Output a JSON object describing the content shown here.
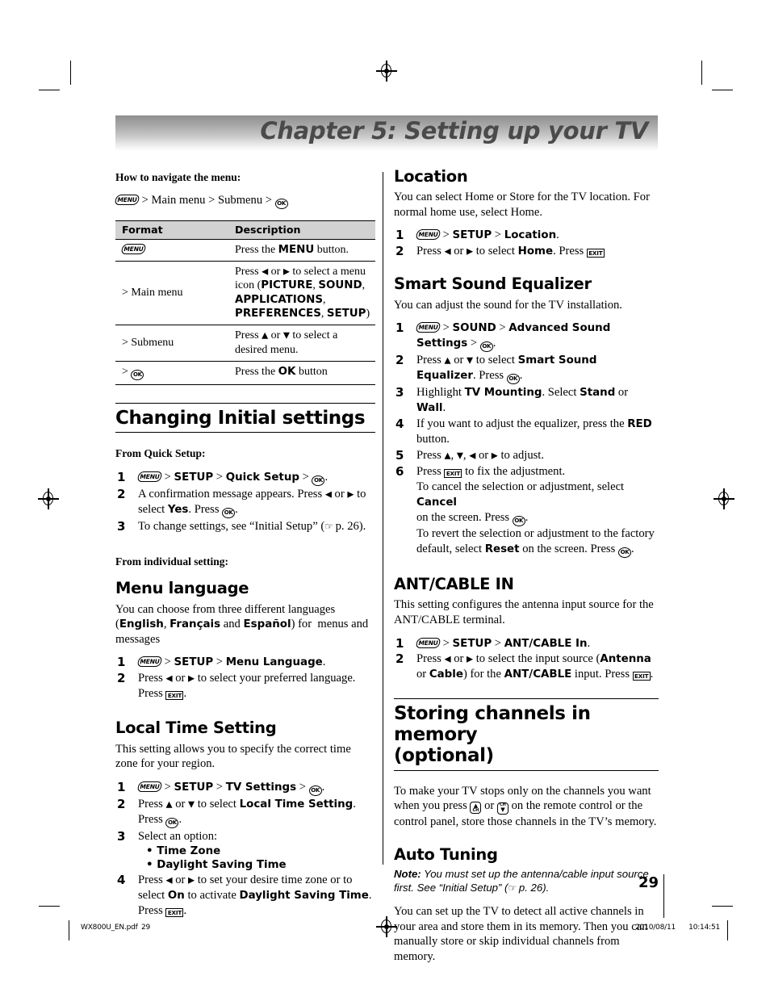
{
  "document": {
    "chapter_title": "Chapter 5: Setting up your TV",
    "page_number": "29",
    "footer_filename": "WX800U_EN.pdf",
    "footer_page": "29",
    "footer_date": "2010/08/11",
    "footer_time": "10:14:51"
  },
  "left_column": {
    "navigate_heading": "How to navigate the menu:",
    "navigate_path": {
      "menu_icon": "menu-key-icon",
      "sep1": ">",
      "main_menu": "Main menu",
      "sep2": ">",
      "submenu": "Submenu",
      "sep3": ">",
      "ok_icon": "ok-key-icon"
    },
    "table": {
      "headers": [
        "Format",
        "Description"
      ],
      "rows": [
        {
          "format_icon": "menu-key-icon",
          "format": "",
          "description_parts": [
            "Press the ",
            "MENU",
            " button."
          ]
        },
        {
          "format": "> Main menu",
          "description_parts": [
            "Press ",
            "◀",
            " or ",
            "▶",
            " to select a menu icon (",
            "PICTURE",
            ", ",
            "SOUND",
            ", ",
            "APPLICATIONS",
            ", ",
            "PREFERENCES",
            ", ",
            "SETUP",
            ")"
          ]
        },
        {
          "format": "> Submenu",
          "description_parts": [
            "Press ",
            "▲",
            " or ",
            "▼",
            " to select a desired menu."
          ]
        },
        {
          "format": ">",
          "format_icon": "ok-key-icon",
          "description_parts": [
            "Press the ",
            "OK",
            " button"
          ]
        }
      ]
    },
    "changing_initial_settings": {
      "heading": "Changing Initial settings",
      "quick_setup_label": "From Quick Setup:",
      "steps": [
        {
          "parts": [
            "MENU_ICON",
            " > ",
            "SETUP",
            " > ",
            "Quick Setup",
            " > ",
            "OK_ICON",
            "."
          ]
        },
        {
          "text": "A confirmation message appears. Press ◀ or ▶ to select Yes. Press OK."
        },
        {
          "text": "To change settings, see “Initial Setup” (☞ p. 26)."
        }
      ],
      "individual_setting_label": "From  individual setting:"
    },
    "menu_language": {
      "heading": "Menu language",
      "body": "You can choose from three different languages (English, Français and Español) for  menus and messages",
      "languages": [
        "English",
        "Français",
        "Español"
      ],
      "steps": [
        {
          "text": "MENU > SETUP > Menu Language."
        },
        {
          "text": "Press ◀ or ▶ to select your preferred language. Press EXIT."
        }
      ]
    },
    "local_time_setting": {
      "heading": "Local Time Setting",
      "body": "This setting allows you to specify the correct time zone for your region.",
      "steps": [
        {
          "text": "MENU > SETUP > TV Settings > OK."
        },
        {
          "text": "Press ▲ or ▼ to select Local Time Setting. Press OK."
        },
        {
          "text": "Select an option:",
          "bullets": [
            "Time Zone",
            "Daylight Saving Time"
          ]
        },
        {
          "text": "Press ◀ or ▶ to set your desire time zone or to select On to activate Daylight Saving Time. Press EXIT."
        }
      ]
    }
  },
  "right_column": {
    "location": {
      "heading": "Location",
      "body": "You can select Home or Store for the TV location. For normal home use, select Home.",
      "steps": [
        {
          "text": "MENU > SETUP > Location."
        },
        {
          "text": "Press ◀ or ▶ to select Home. Press EXIT"
        }
      ]
    },
    "smart_sound_equalizer": {
      "heading": "Smart Sound Equalizer",
      "body": "You can adjust the sound for the TV installation.",
      "steps": [
        {
          "text": "MENU > SOUND > Advanced Sound Settings > OK."
        },
        {
          "text": "Press ▲ or ▼ to select Smart Sound Equalizer. Press OK."
        },
        {
          "text": "Highlight TV Mounting. Select Stand or Wall."
        },
        {
          "text": "If you want to adjust the equalizer, press the RED button."
        },
        {
          "text": "Press ▲, ▼, ◀ or ▶ to adjust."
        },
        {
          "text": "Press EXIT to fix the adjustment. To cancel the selection or adjustment, select Cancel on the screen. Press OK. To revert the selection or adjustment to the factory default, select Reset on the screen. Press OK."
        }
      ]
    },
    "ant_cable_in": {
      "heading": "ANT/CABLE IN",
      "body": "This setting configures the antenna input source for the ANT/CABLE terminal.",
      "steps": [
        {
          "text": "MENU > SETUP > ANT/CABLE In."
        },
        {
          "text": "Press ◀ or ▶ to select the input source (Antenna or Cable) for the ANT/CABLE input. Press EXIT."
        }
      ]
    },
    "storing_channels": {
      "heading_line1": "Storing channels in memory",
      "heading_line2": "(optional)",
      "body": "To make your TV stops only on the channels you want when you press CH▲ or CH▼ on the remote control or the control panel, store those channels in the TV’s memory."
    },
    "auto_tuning": {
      "heading": "Auto Tuning",
      "note_label": "Note:",
      "note_text": "You must set up the antenna/cable input source first. See “Initial Setup” (☞ p. 26).",
      "body": "You can set up the TV to detect all active channels in your area and store them in its memory. Then you can manually store or skip individual channels from memory."
    }
  },
  "icons": {
    "menu_key_label": "MENU",
    "ok_key_label": "OK",
    "exit_key_label": "EXIT",
    "ch_key_label": "CH",
    "hand_pointer": "☞"
  },
  "colors": {
    "banner_dark": "#8f8f8f",
    "banner_light": "#ffffff",
    "banner_text": "#4a4a4a",
    "table_header_bg": "#d2d2d2",
    "ink": "#000000"
  }
}
